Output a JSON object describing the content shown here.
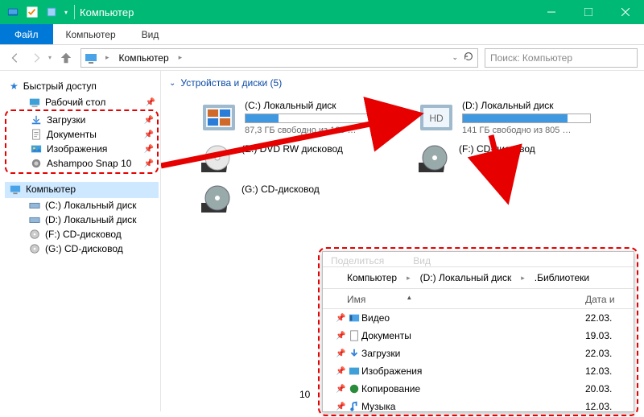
{
  "titlebar": {
    "title": "Компьютер"
  },
  "ribbon": {
    "file": "Файл",
    "tabs": [
      "Компьютер",
      "Вид"
    ]
  },
  "addressbar": {
    "crumb1": "Компьютер"
  },
  "search": {
    "placeholder": "Поиск: Компьютер"
  },
  "sidebar": {
    "quick": {
      "label": "Быстрый доступ",
      "items": [
        {
          "label": "Рабочий стол"
        },
        {
          "label": "Загрузки"
        },
        {
          "label": "Документы"
        },
        {
          "label": "Изображения"
        },
        {
          "label": "Ashampoo Snap 10"
        }
      ]
    },
    "computer": {
      "label": "Компьютер",
      "items": [
        {
          "label": "(C:) Локальный диск"
        },
        {
          "label": "(D:) Локальный диск"
        },
        {
          "label": "(F:) CD-дисковод"
        },
        {
          "label": "(G:) CD-дисковод"
        }
      ]
    }
  },
  "content": {
    "section_title": "Устройства и диски (5)",
    "drives": {
      "c": {
        "title": "(C:) Локальный диск",
        "sub": "87,3 ГБ свободно из 120 …",
        "pct": 26
      },
      "d": {
        "title": "(D:) Локальный диск",
        "sub": "141 ГБ свободно из 805 …",
        "pct": 82
      },
      "e": {
        "title": "(E:) DVD RW дисковод"
      },
      "f": {
        "title": "(F:) CD-дисковод"
      },
      "g": {
        "title": "(G:) CD-дисковод"
      }
    }
  },
  "inset": {
    "tabs_ghost": [
      "Поделиться",
      "Вид"
    ],
    "crumbs": [
      "Компьютер",
      "(D:) Локальный диск",
      ".Библиотеки"
    ],
    "cols": {
      "name": "Имя",
      "date": "Дата и"
    },
    "rows": [
      {
        "name": "Видео",
        "date": "22.03.",
        "icon": "video"
      },
      {
        "name": "Документы",
        "date": "19.03.",
        "icon": "doc"
      },
      {
        "name": "Загрузки",
        "date": "22.03.",
        "icon": "down"
      },
      {
        "name": "Изображения",
        "date": "12.03.",
        "icon": "img"
      },
      {
        "name": "Копирование",
        "date": "20.03.",
        "icon": "copy"
      },
      {
        "name": "Музыка",
        "date": "12.03.",
        "icon": "music"
      }
    ],
    "count": "10"
  }
}
